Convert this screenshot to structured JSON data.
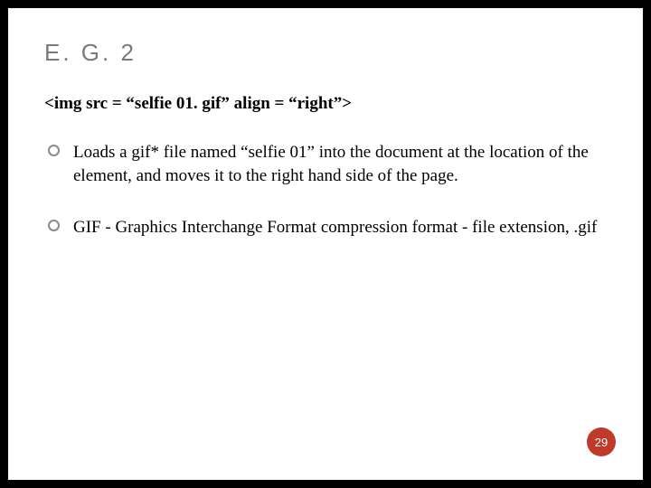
{
  "title": "E. G. 2",
  "code_line": "<img src = “selfie 01. gif” align = “right”>",
  "bullets": [
    "Loads a gif* file named “selfie 01” into the document at the location of the element, and moves it to the right hand side of the page.",
    "GIF - Graphics Interchange Format compression format - file extension, .gif"
  ],
  "page_number": "29"
}
